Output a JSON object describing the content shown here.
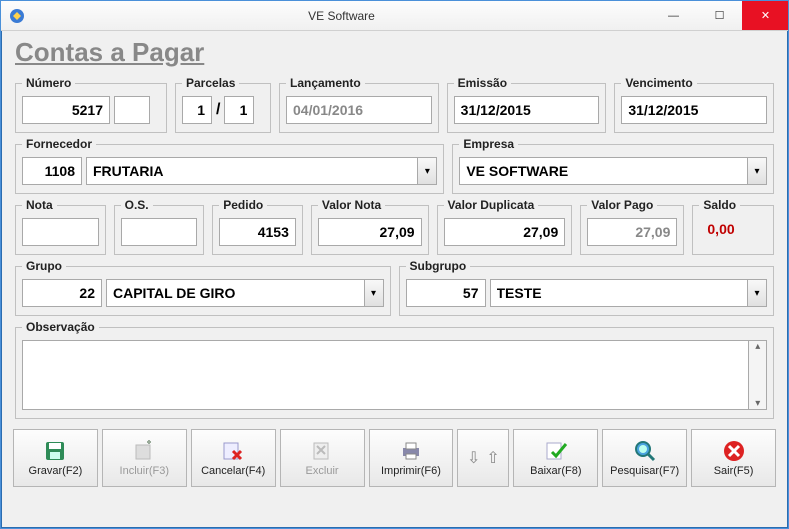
{
  "window": {
    "title": "VE Software"
  },
  "page": {
    "title": "Contas a Pagar"
  },
  "numero": {
    "label": "Número",
    "value": "5217",
    "aux": ""
  },
  "parcelas": {
    "label": "Parcelas",
    "atual": "1",
    "total": "1"
  },
  "lancamento": {
    "label": "Lançamento",
    "value": "04/01/2016"
  },
  "emissao": {
    "label": "Emissão",
    "value": "31/12/2015"
  },
  "vencimento": {
    "label": "Vencimento",
    "value": "31/12/2015"
  },
  "fornecedor": {
    "label": "Fornecedor",
    "codigo": "1108",
    "nome": "FRUTARIA"
  },
  "empresa": {
    "label": "Empresa",
    "nome": "VE SOFTWARE"
  },
  "nota": {
    "label": "Nota",
    "value": ""
  },
  "os": {
    "label": "O.S.",
    "value": ""
  },
  "pedido": {
    "label": "Pedido",
    "value": "4153"
  },
  "valor_nota": {
    "label": "Valor Nota",
    "value": "27,09"
  },
  "valor_duplicata": {
    "label": "Valor Duplicata",
    "value": "27,09"
  },
  "valor_pago": {
    "label": "Valor Pago",
    "value": "27,09"
  },
  "saldo": {
    "label": "Saldo",
    "value": "0,00"
  },
  "grupo": {
    "label": "Grupo",
    "codigo": "22",
    "nome": "CAPITAL DE GIRO"
  },
  "subgrupo": {
    "label": "Subgrupo",
    "codigo": "57",
    "nome": "TESTE"
  },
  "observacao": {
    "label": "Observação",
    "value": ""
  },
  "buttons": {
    "gravar": "Gravar(F2)",
    "incluir": "Incluir(F3)",
    "cancelar": "Cancelar(F4)",
    "excluir": "Excluir",
    "imprimir": "Imprimir(F6)",
    "baixar": "Baixar(F8)",
    "pesquisar": "Pesquisar(F7)",
    "sair": "Sair(F5)"
  }
}
